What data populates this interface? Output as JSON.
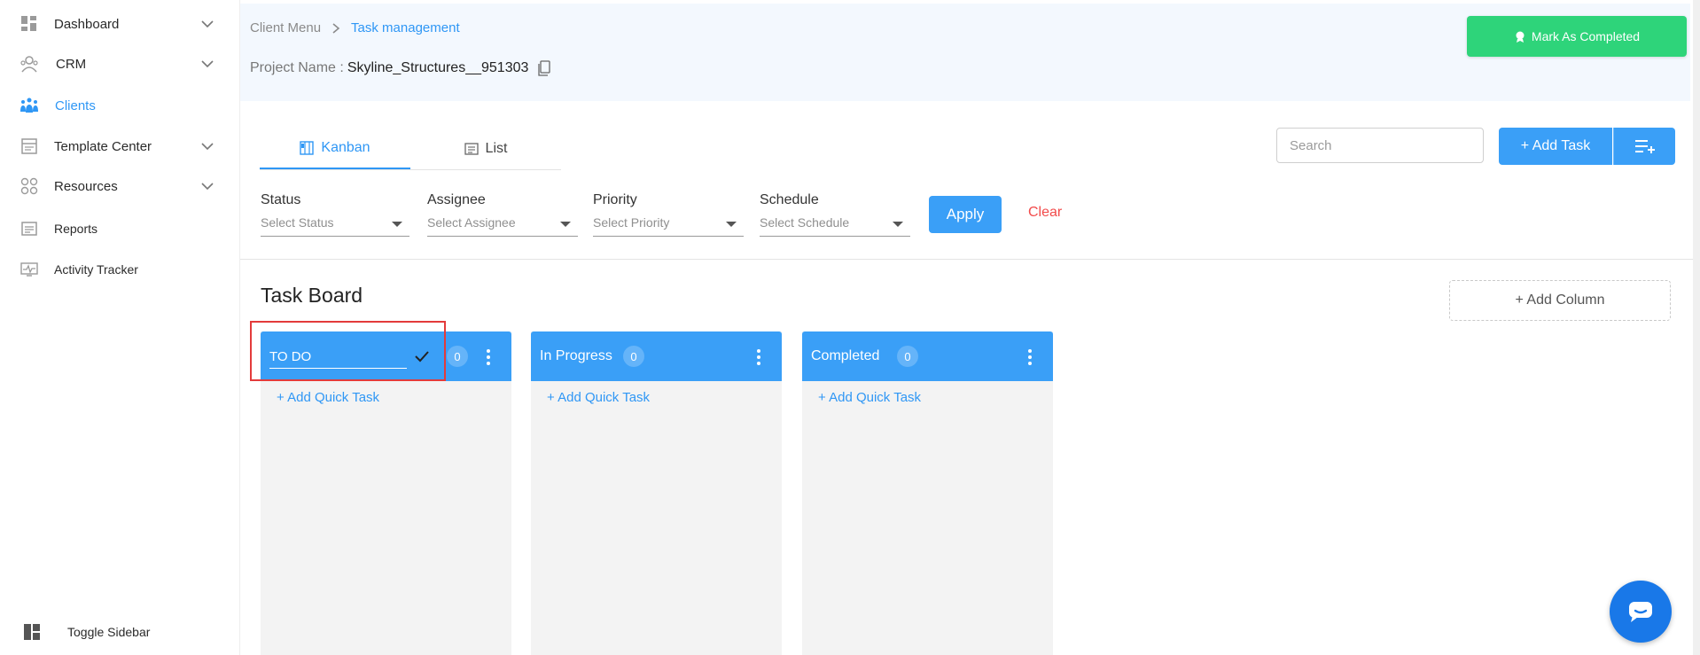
{
  "sidebar": {
    "items": [
      {
        "label": "Dashboard",
        "icon": "dashboard-icon",
        "has_chevron": true
      },
      {
        "label": "CRM",
        "icon": "crm-icon",
        "has_chevron": true
      },
      {
        "label": "Clients",
        "icon": "clients-icon",
        "has_chevron": false,
        "active": true
      },
      {
        "label": "Template Center",
        "icon": "template-icon",
        "has_chevron": true
      },
      {
        "label": "Resources",
        "icon": "resources-icon",
        "has_chevron": true
      },
      {
        "label": "Reports",
        "icon": "reports-icon",
        "has_chevron": false
      },
      {
        "label": "Activity Tracker",
        "icon": "activity-icon",
        "has_chevron": false
      }
    ],
    "toggle_label": "Toggle Sidebar"
  },
  "header": {
    "breadcrumb": [
      "Client Menu",
      "Task management"
    ],
    "project_label": "Project Name :",
    "project_value": "Skyline_Structures__951303",
    "mark_completed": "Mark As Completed"
  },
  "tabs": [
    {
      "label": "Kanban",
      "active": true
    },
    {
      "label": "List",
      "active": false
    }
  ],
  "search": {
    "placeholder": "Search",
    "value": ""
  },
  "add_task_label": "+ Add Task",
  "filters": [
    {
      "label": "Status",
      "placeholder": "Select Status"
    },
    {
      "label": "Assignee",
      "placeholder": "Select Assignee"
    },
    {
      "label": "Priority",
      "placeholder": "Select Priority"
    },
    {
      "label": "Schedule",
      "placeholder": "Select Schedule"
    }
  ],
  "apply_label": "Apply",
  "clear_label": "Clear",
  "board": {
    "title": "Task Board",
    "add_column_label": "+ Add Column",
    "columns": [
      {
        "title": "TO DO",
        "count": "0",
        "editing": true,
        "quick_task": "+ Add Quick Task"
      },
      {
        "title": "In Progress",
        "count": "0",
        "editing": false,
        "quick_task": "+ Add Quick Task"
      },
      {
        "title": "Completed",
        "count": "0",
        "editing": false,
        "quick_task": "+ Add Quick Task"
      }
    ]
  },
  "colors": {
    "accent": "#3a9ff7",
    "success": "#2ed47a",
    "danger": "#f24b4b",
    "highlight": "#e33b3b"
  }
}
